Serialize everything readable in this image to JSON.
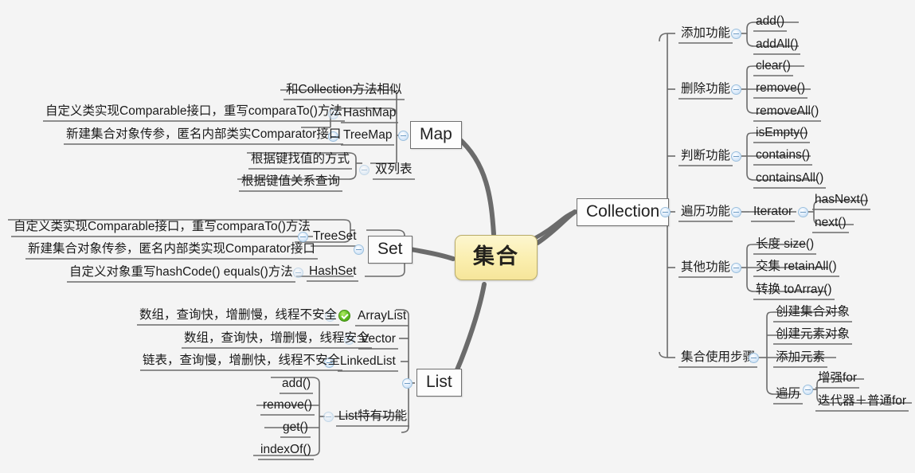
{
  "diagram": {
    "type": "mind-map",
    "title": "集合",
    "background": "#f4f4f4",
    "central_color": "#faeeae",
    "accent_color": "#6f9cc4",
    "ok_color": "#63c024"
  },
  "central": {
    "label": "集合"
  },
  "branches": {
    "collection": {
      "label": "Collection",
      "groups": {
        "add": {
          "label": "添加功能",
          "items": [
            "add()",
            "addAll()"
          ]
        },
        "remove": {
          "label": "删除功能",
          "items": [
            "clear()",
            "remove()",
            "removeAll()"
          ]
        },
        "judge": {
          "label": "判断功能",
          "items": [
            "isEmpty()",
            "contains()",
            "containsAll()"
          ]
        },
        "iterate": {
          "label": "遍历功能",
          "child": "Iterator",
          "items": [
            "hasNext()",
            "next()"
          ]
        },
        "other": {
          "label": "其他功能",
          "items": [
            "长度 size()",
            "交集 retainAll()",
            "转换 toArray()"
          ]
        },
        "steps": {
          "label": "集合使用步骤",
          "items": [
            "创建集合对象",
            "创建元素对象",
            "添加元素"
          ],
          "traverse": {
            "label": "遍历",
            "items": [
              "增强for",
              "迭代器＋普通for"
            ]
          }
        }
      }
    },
    "map": {
      "label": "Map",
      "top_note": "和Collection方法相似",
      "children": [
        {
          "label": "HashMap",
          "note": "自定义类实现Comparable接口，重写comparaTo()方法"
        },
        {
          "label": "TreeMap",
          "note": "新建集合对象传参，匿名内部类实Comparator接口"
        }
      ],
      "dual": {
        "label": "双列表",
        "items": [
          "根据键找值的方式",
          "根据键值关系查询"
        ]
      }
    },
    "set": {
      "label": "Set",
      "children": [
        {
          "label": "TreeSet",
          "notes": [
            "自定义类实现Comparable接口，重写comparaTo()方法",
            "新建集合对象传参，匿名内部类实现Comparator接口"
          ]
        },
        {
          "label": "HashSet",
          "notes": [
            "自定义对象重写hashCode() equals()方法"
          ]
        }
      ]
    },
    "list": {
      "label": "List",
      "children": [
        {
          "label": "ArrayList",
          "note": "数组，查询快，增删慢，线程不安全",
          "marked": true
        },
        {
          "label": "Vector",
          "note": "数组，查询快，增删慢，线程安全",
          "marked": false
        },
        {
          "label": "LinkedList",
          "note": "链表，查询慢，增删快，线程不安全",
          "marked": false
        }
      ],
      "special": {
        "label": "List特有功能",
        "items": [
          "add()",
          "remove()",
          "get()",
          "indexOf()"
        ]
      }
    }
  }
}
